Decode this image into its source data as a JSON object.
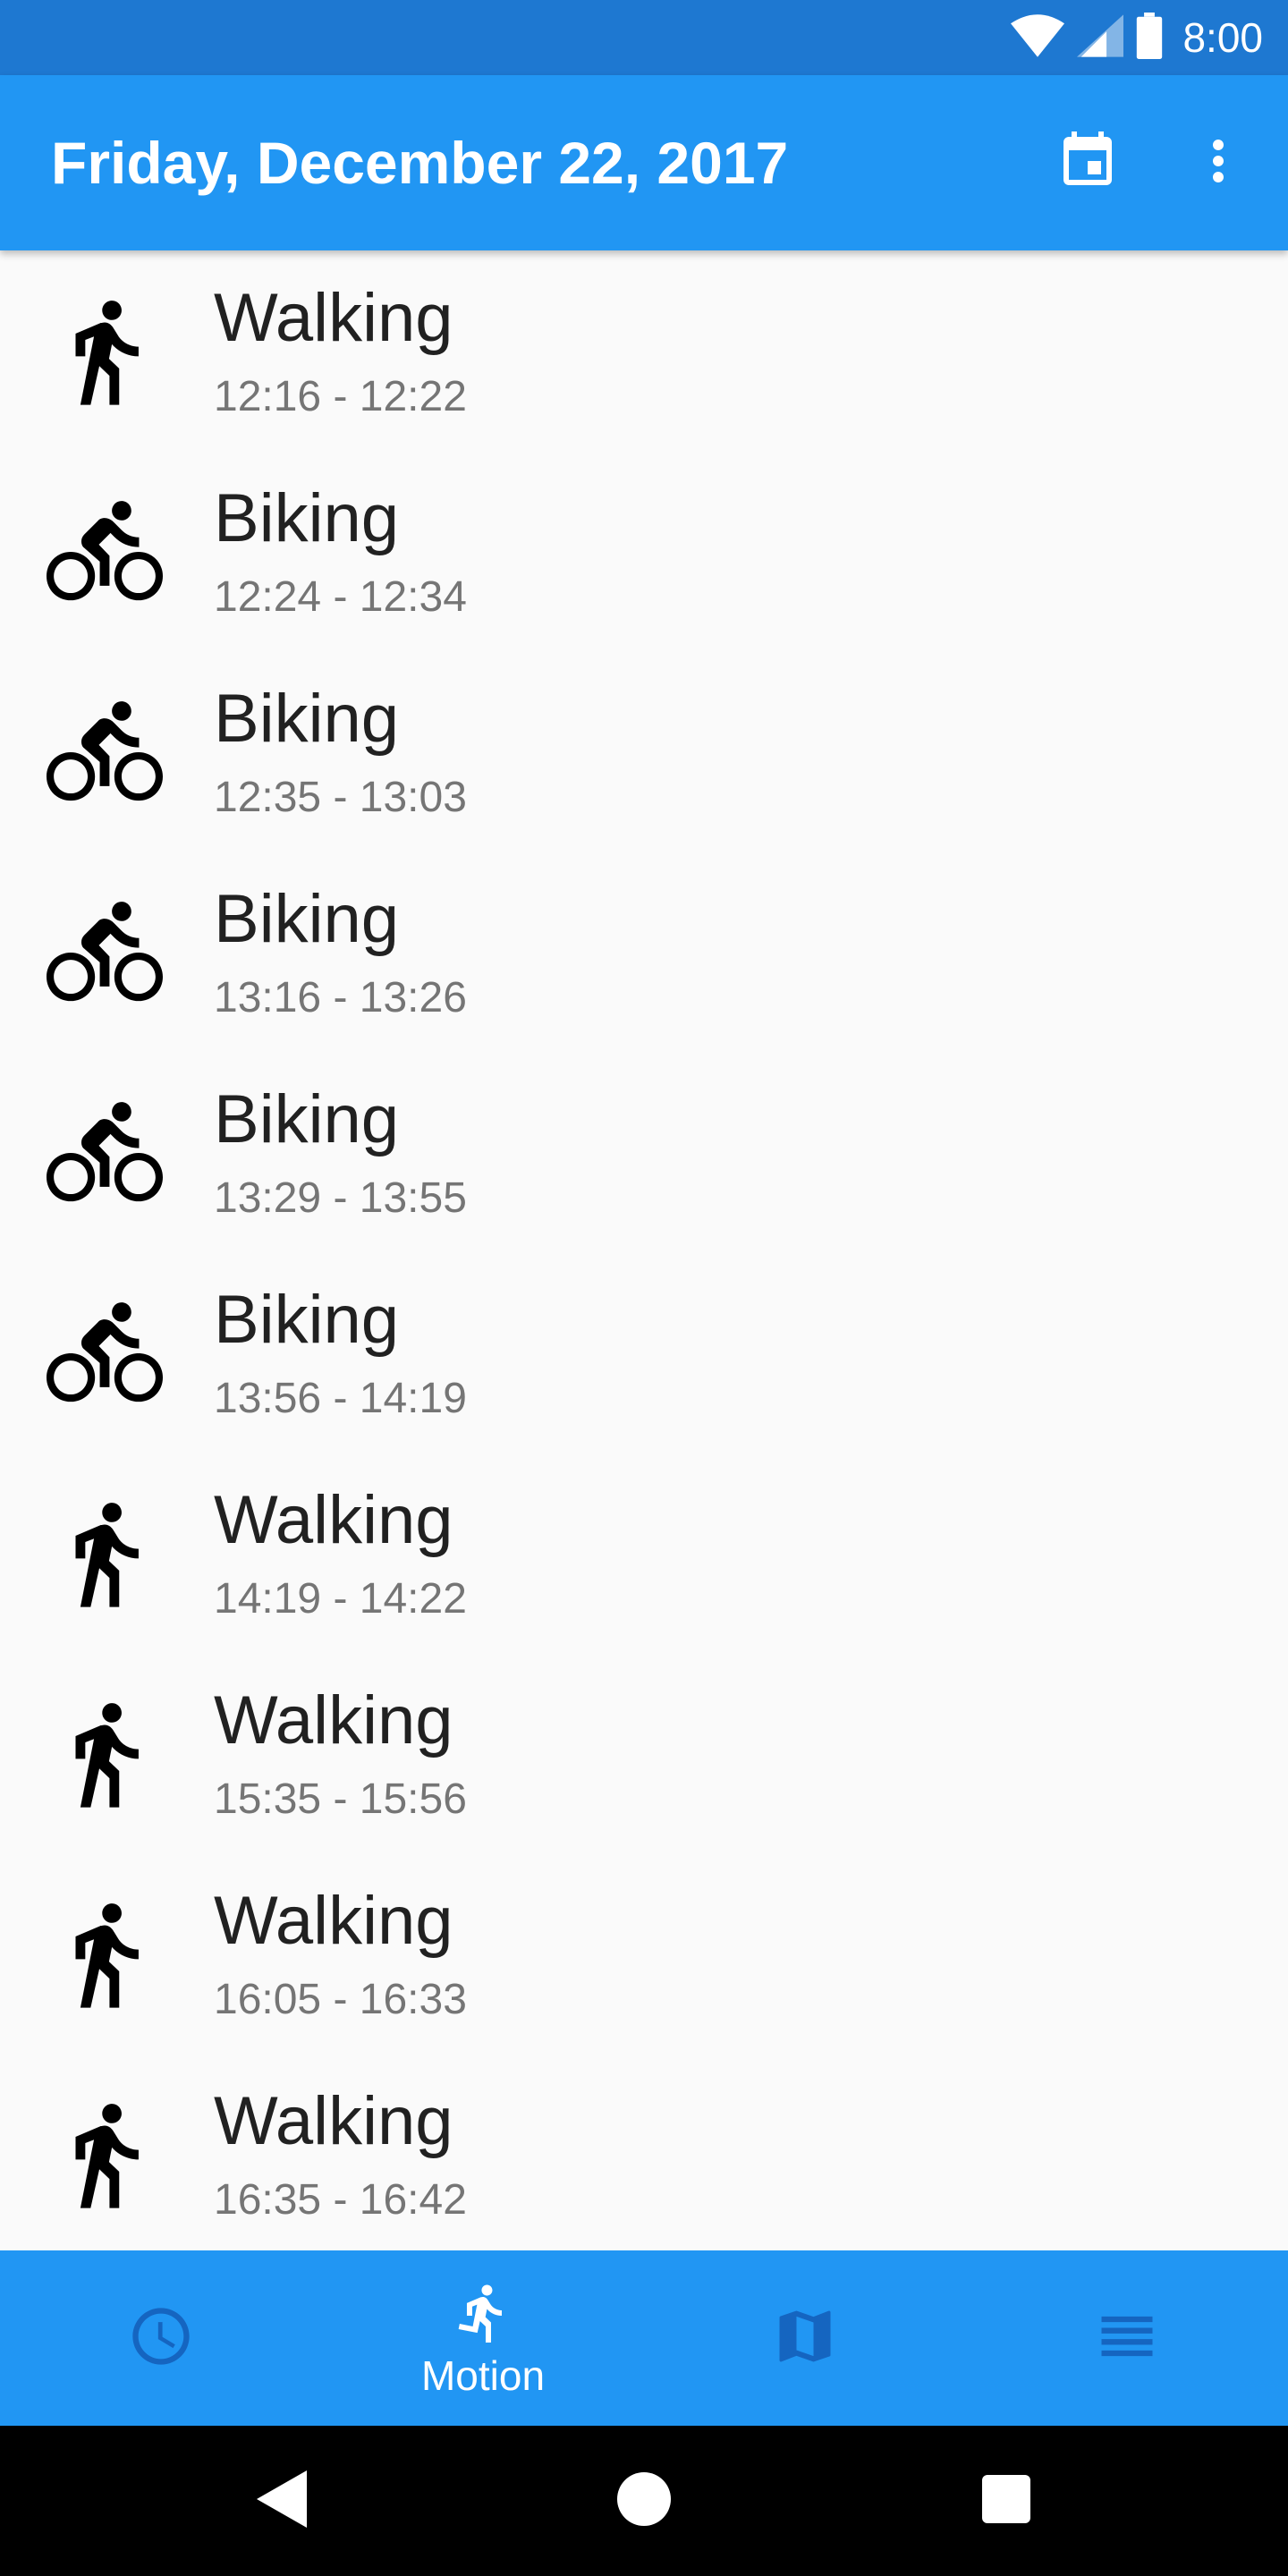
{
  "status_bar": {
    "time": "8:00",
    "icons": [
      "wifi-icon",
      "cell-signal-icon",
      "battery-icon"
    ]
  },
  "app_bar": {
    "title": "Friday, December 22, 2017",
    "actions": [
      "calendar-icon",
      "more-vert-icon"
    ]
  },
  "activities": [
    {
      "type": "walking",
      "label": "Walking",
      "time": "12:16 - 12:22"
    },
    {
      "type": "biking",
      "label": "Biking",
      "time": "12:24 - 12:34"
    },
    {
      "type": "biking",
      "label": "Biking",
      "time": "12:35 - 13:03"
    },
    {
      "type": "biking",
      "label": "Biking",
      "time": "13:16 - 13:26"
    },
    {
      "type": "biking",
      "label": "Biking",
      "time": "13:29 - 13:55"
    },
    {
      "type": "biking",
      "label": "Biking",
      "time": "13:56 - 14:19"
    },
    {
      "type": "walking",
      "label": "Walking",
      "time": "14:19 - 14:22"
    },
    {
      "type": "walking",
      "label": "Walking",
      "time": "15:35 - 15:56"
    },
    {
      "type": "walking",
      "label": "Walking",
      "time": "16:05 - 16:33"
    },
    {
      "type": "walking",
      "label": "Walking",
      "time": "16:35 - 16:42"
    }
  ],
  "bottom_nav": {
    "tabs": [
      {
        "icon": "clock-icon",
        "label": "",
        "active": false
      },
      {
        "icon": "running-icon",
        "label": "Motion",
        "active": true
      },
      {
        "icon": "map-icon",
        "label": "",
        "active": false
      },
      {
        "icon": "list-icon",
        "label": "",
        "active": false
      }
    ]
  },
  "system_nav": [
    "back-icon",
    "home-icon",
    "recents-icon"
  ],
  "colors": {
    "status_bar": "#1e78d1",
    "app_bar": "#2196f3",
    "background": "#fafafa",
    "nav_inactive": "#1565c0",
    "title_text": "#212121",
    "secondary_text": "#757575"
  }
}
